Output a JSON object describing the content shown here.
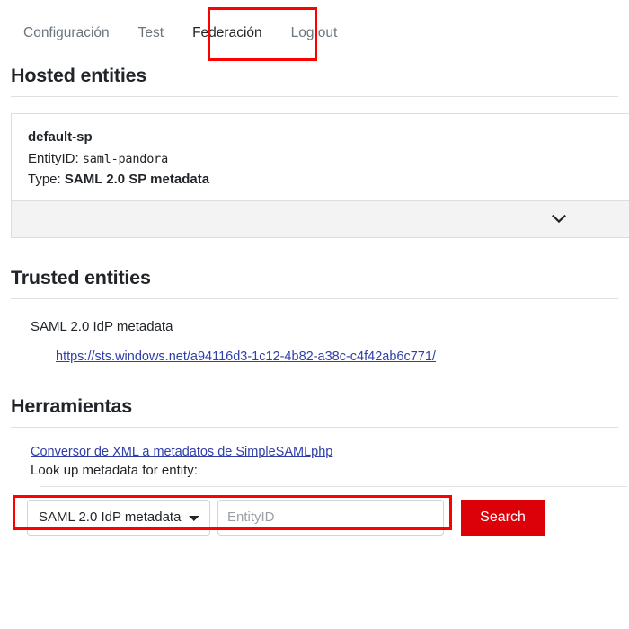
{
  "nav": {
    "tabs": [
      {
        "label": "Configuración",
        "active": false
      },
      {
        "label": "Test",
        "active": false
      },
      {
        "label": "Federación",
        "active": true
      },
      {
        "label": "Log out",
        "active": false
      }
    ]
  },
  "hosted": {
    "title": "Hosted entities",
    "entity": {
      "name": "default-sp",
      "entity_id_label": "EntityID:",
      "entity_id_value": "saml-pandora",
      "type_label": "Type:",
      "type_value": "SAML 2.0 SP metadata"
    },
    "expand_icon": "chevron-down-icon"
  },
  "trusted": {
    "title": "Trusted entities",
    "items": [
      {
        "type": "SAML 2.0 IdP metadata",
        "url": "https://sts.windows.net/a94116d3-1c12-4b82-a38c-c4f42ab6c771/"
      }
    ]
  },
  "tools": {
    "title": "Herramientas",
    "converter_link": "Conversor de XML a metadatos de SimpleSAMLphp",
    "lookup_label": "Look up metadata for entity:",
    "select_value": "SAML 2.0 IdP metadata",
    "select_options": [
      "SAML 2.0 IdP metadata"
    ],
    "entity_placeholder": "EntityID",
    "entity_value": "",
    "search_label": "Search"
  },
  "colors": {
    "annotation": "#fe0000",
    "search_button": "#dc0008",
    "link": "#2f3ea8",
    "tab_inactive": "#6c757d",
    "card_footer": "#f3f3f3"
  },
  "annotations": [
    {
      "name": "highlight-federacion-tab"
    },
    {
      "name": "highlight-converter-link"
    }
  ]
}
